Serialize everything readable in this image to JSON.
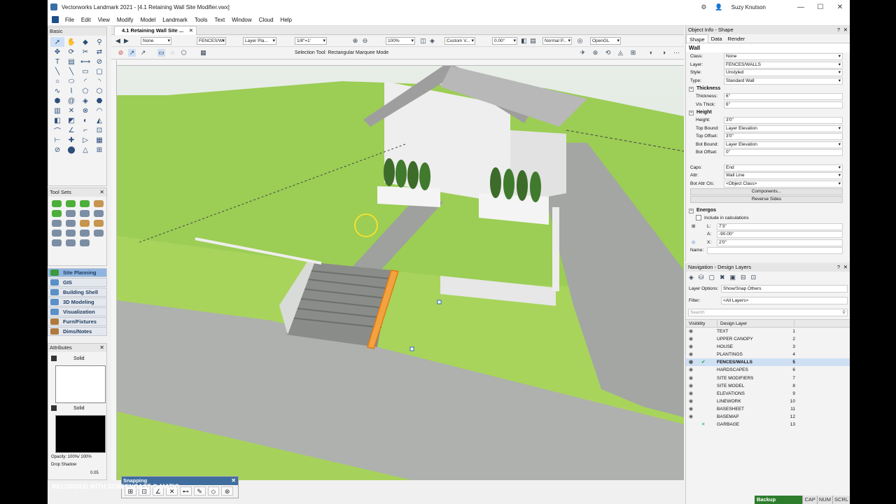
{
  "window": {
    "title": "Vectorworks Landmark 2021 - [4.1 Retaining Wall Site Modifier.vwx]",
    "user": "Suzy Knutson"
  },
  "menu": [
    "File",
    "Edit",
    "View",
    "Modify",
    "Model",
    "Landmark",
    "Tools",
    "Text",
    "Window",
    "Cloud",
    "Help"
  ],
  "basic_palette": {
    "title": "Basic"
  },
  "toolsets_palette": {
    "title": "Tool Sets"
  },
  "categories": [
    "Site Planning",
    "GIS",
    "Building Shell",
    "3D Modeling",
    "Visualization",
    "Furn/Fixtures",
    "Dims/Notes"
  ],
  "attributes": {
    "title": "Attributes",
    "fill_style": "Solid",
    "pen_style": "Solid",
    "opacity": "Opacity: 100%/ 100%",
    "drop_shadow": "Drop Shadow",
    "line_weight": "0.05"
  },
  "document_tab": "4.1 Retaining Wall Site ...",
  "view_bar": {
    "class": "None",
    "layer": "FENCES/W...",
    "layer_plane": "Layer Pla...",
    "scale": "1/8\"=1'",
    "zoom": "100%",
    "view": "Custom V...",
    "angle": "0.00°",
    "render_quality": "Normal P...",
    "render_mode": "OpenGL"
  },
  "mode_text": "Selection Tool: Rectangular Marquee Mode",
  "snapping": {
    "title": "Snapping"
  },
  "object_info": {
    "title": "Object Info - Shape",
    "tabs": [
      "Shape",
      "Data",
      "Render"
    ],
    "object_type": "Wall",
    "class": "None",
    "layer": "FENCES/WALLS",
    "style": "Unstyled",
    "type": "Standard Wall",
    "thickness_section": "Thickness",
    "thickness": "6\"",
    "vis_thick": "6\"",
    "height_section": "Height",
    "height": "3'0\"",
    "top_bound": "Layer Elevation",
    "top_offset": "3'0\"",
    "bot_bound": "Layer Elevation",
    "bot_offset": "0\"",
    "caps": "End",
    "attr": "Wall Line",
    "bot_attr_cls": "<Object Class>",
    "components_button": "Components...",
    "reverse_sides_button": "Reverse Sides",
    "energos_section": "Energos",
    "include_calc": "Include in calculations",
    "L_label": "L:",
    "L": "7'3\"",
    "A_label": "A:",
    "A": "-90.00°",
    "X_label": "X:",
    "X": "2'0\"",
    "name_label": "Name:",
    "labels": {
      "class": "Class:",
      "layer": "Layer:",
      "style": "Style:",
      "type": "Type:",
      "thickness": "Thickness:",
      "vis_thick": "Vis Thick:",
      "height": "Height:",
      "top_bound": "Top Bound:",
      "top_offset": "Top Offset:",
      "bot_bound": "Bot Bound:",
      "bot_offset": "Bot Offset:",
      "caps": "Caps:",
      "attr": "Attr:",
      "bot_attr_cls": "Bot Attr Cls:"
    }
  },
  "navigation": {
    "title": "Navigation - Design Layers",
    "layer_options_label": "Layer Options:",
    "layer_options": "Show/Snap Others",
    "filter_label": "Filter:",
    "filter": "<All Layers>",
    "search_placeholder": "Search",
    "col_visibility": "Visibility",
    "col_design_layer": "Design Layer",
    "layers": [
      {
        "name": "TEXT",
        "num": "1"
      },
      {
        "name": "UPPER CANOPY",
        "num": "2"
      },
      {
        "name": "HOUSE",
        "num": "3"
      },
      {
        "name": "PLANTINGS",
        "num": "4"
      },
      {
        "name": "FENCES/WALLS",
        "num": "5"
      },
      {
        "name": "HARDSCAPES",
        "num": "6"
      },
      {
        "name": "SITE MODIFIERS",
        "num": "7"
      },
      {
        "name": "SITE MODEL",
        "num": "8"
      },
      {
        "name": "ELEVATIONS",
        "num": "9"
      },
      {
        "name": "LINEWORK",
        "num": "10"
      },
      {
        "name": "BASESHEET",
        "num": "11"
      },
      {
        "name": "BASEMAP",
        "num": "12"
      },
      {
        "name": "GARBAGE",
        "num": "13"
      }
    ],
    "active_layer": "FENCES/WALLS"
  },
  "status": {
    "backup": "Backup complete.",
    "cap": "CAP",
    "num": "NUM",
    "scrl": "SCRL"
  },
  "watermark": "RECORDED WITH SCREENCAST-O-MATIC"
}
